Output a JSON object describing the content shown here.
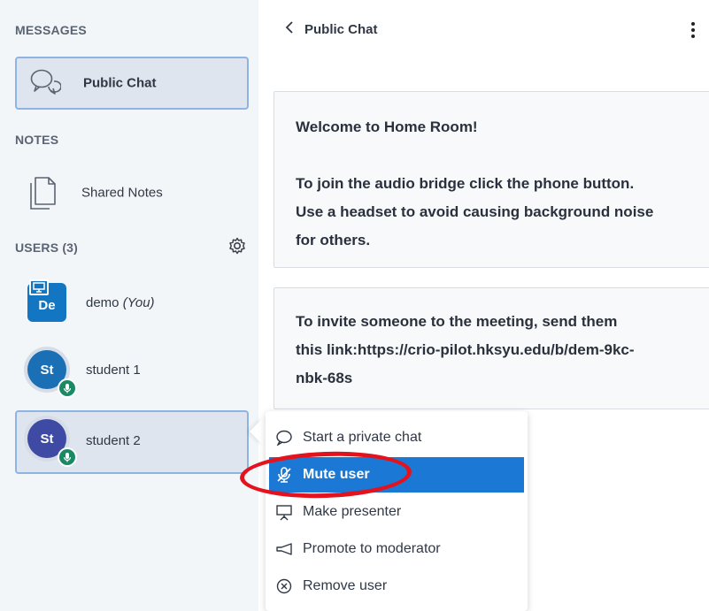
{
  "sidebar": {
    "messages_title": "MESSAGES",
    "public_chat_label": "Public Chat",
    "notes_title": "NOTES",
    "shared_notes_label": "Shared Notes",
    "users_title": "USERS (3)",
    "users": [
      {
        "initials": "De",
        "name": "demo",
        "suffix": "(You)",
        "color": "#1276c2"
      },
      {
        "initials": "St",
        "name": "student 1",
        "color": "#1a6fb5"
      },
      {
        "initials": "St",
        "name": "student 2",
        "color": "#3e4aa3"
      }
    ]
  },
  "chat": {
    "title": "Public Chat",
    "welcome_lines": [
      "Welcome to Home Room!",
      "",
      "To join the audio bridge click the phone button.",
      "Use a headset to avoid causing background noise",
      "for others."
    ],
    "invite_lines": [
      "To invite someone to the meeting, send them",
      "this link:https://crio-pilot.hksyu.edu/b/dem-9kc-",
      "nbk-68s"
    ]
  },
  "menu": {
    "items": [
      {
        "label": "Start a private chat",
        "icon": "chat-bubble-icon"
      },
      {
        "label": "Mute user",
        "icon": "mic-off-icon"
      },
      {
        "label": "Make presenter",
        "icon": "presentation-icon"
      },
      {
        "label": "Promote to moderator",
        "icon": "megaphone-icon"
      },
      {
        "label": "Remove user",
        "icon": "remove-circle-icon"
      }
    ]
  },
  "colors": {
    "sidebar_bg": "#f3f6f9",
    "active_border": "#8db4e2",
    "menu_highlight": "#1b78d4",
    "mic_badge": "#1a8a64",
    "annotation_red": "#e3121d"
  }
}
